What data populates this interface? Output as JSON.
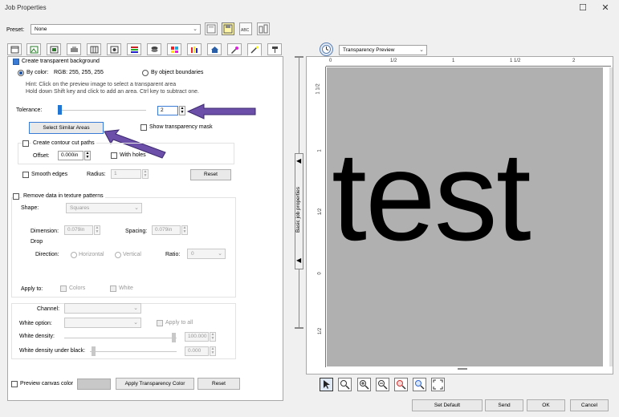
{
  "window": {
    "title": "Job Properties",
    "minimize_glyph": "☐",
    "close_glyph": "✕"
  },
  "toolbar": {
    "preset_label": "Preset:",
    "preset_value": "None",
    "icons": [
      "save-icon",
      "save-highlighted-icon",
      "abc-text-icon",
      "upload-icon"
    ]
  },
  "tabs": {
    "icons": [
      "page-icon",
      "image-icon",
      "layout-icon",
      "printer-icon",
      "grid-icon",
      "target-icon",
      "layers-icon",
      "stack-icon",
      "color-swatch-icon",
      "bar-color-icon",
      "house-icon",
      "magic-color-icon",
      "magic-wand-icon",
      "pin-icon"
    ],
    "selected_index": 12
  },
  "transparency": {
    "create_bg_label": "Create transparent background",
    "by_color_label": "By color:",
    "rgb_label": "RGB: 255, 255, 255",
    "by_object_label": "By object boundaries",
    "hint_line1": "Hint: Click on the preview image to select a transparent area",
    "hint_line2": "Hold down Shift key and click to add an area. Ctrl key to subtract one.",
    "tolerance_label": "Tolerance:",
    "tolerance_value": "2",
    "select_similar_label": "Select Similar Areas",
    "show_mask_label": "Show transparency mask",
    "contour_label": "Create contour cut paths",
    "offset_label": "Offset:",
    "offset_value": "0.000in",
    "with_holes_label": "With holes",
    "smooth_label": "Smooth edges",
    "radius_label": "Radius:",
    "radius_value": "1",
    "reset_label": "Reset"
  },
  "texture": {
    "remove_label": "Remove data in texture patterns",
    "shape_label": "Shape:",
    "shape_value": "Squares",
    "dimension_label": "Dimension:",
    "dimension_value": "0.079in",
    "spacing_label": "Spacing:",
    "spacing_value": "0.079in",
    "drop_label": "Drop",
    "direction_label": "Direction:",
    "horizontal_label": "Horizontal",
    "vertical_label": "Vertical",
    "ratio_label": "Ratio:",
    "ratio_value": "0",
    "apply_to_label": "Apply to:",
    "colors_label": "Colors",
    "white_label": "White"
  },
  "white": {
    "channel_label": "Channel:",
    "white_option_label": "White option:",
    "apply_all_label": "Apply to all",
    "white_density_label": "White density:",
    "white_density_value": "100.000",
    "under_black_label": "White density under black:",
    "under_black_value": "0.000"
  },
  "bottom": {
    "preview_canvas_label": "Preview canvas color",
    "apply_transparency_label": "Apply Transparency Color",
    "reset_label": "Reset"
  },
  "preview": {
    "mode_value": "Transparency Preview",
    "collapse_label": "Basic job properties",
    "ruler_top": [
      "0",
      "1/2",
      "1",
      "1 1/2",
      "2"
    ],
    "ruler_left": [
      "1 1/2",
      "1",
      "1/2",
      "0",
      "1/2"
    ],
    "sample_text": "test",
    "tools": [
      "pointer-icon",
      "zoom-tool-icon",
      "zoom-in-icon",
      "zoom-out-icon",
      "zoom-selection-icon",
      "zoom-fit-icon",
      "fullscreen-icon"
    ]
  },
  "footer": {
    "set_default_label": "Set Default",
    "send_label": "Send",
    "ok_label": "OK",
    "cancel_label": "Cancel"
  },
  "colors": {
    "accent": "#3a7bd5",
    "arrow": "#6b4fa8",
    "canvas_gray": "#b0b0b0"
  }
}
